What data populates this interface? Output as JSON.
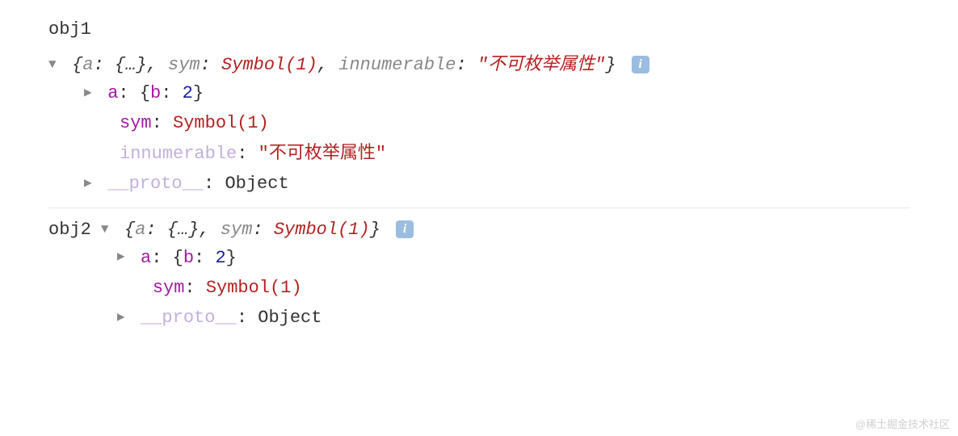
{
  "obj1": {
    "label": "obj1",
    "summary": {
      "a_key": "a",
      "a_val": "{…}",
      "sym_key": "sym",
      "sym_val": "Symbol(1)",
      "innum_key": "innumerable",
      "innum_val": "\"不可枚举属性\""
    },
    "props": {
      "a_key": "a",
      "a_b_key": "b",
      "a_b_val": "2",
      "sym_key": "sym",
      "sym_val": "Symbol(1)",
      "innum_key": "innumerable",
      "innum_val": "\"不可枚举属性\"",
      "proto_key": "__proto__",
      "proto_val": "Object"
    }
  },
  "obj2": {
    "label": "obj2",
    "summary": {
      "a_key": "a",
      "a_val": "{…}",
      "sym_key": "sym",
      "sym_val": "Symbol(1)"
    },
    "props": {
      "a_key": "a",
      "a_b_key": "b",
      "a_b_val": "2",
      "sym_key": "sym",
      "sym_val": "Symbol(1)",
      "proto_key": "__proto__",
      "proto_val": "Object"
    }
  },
  "icons": {
    "info": "i",
    "arrow_down": "▼",
    "arrow_right": "▶"
  },
  "watermark": "@稀土掘金技术社区"
}
